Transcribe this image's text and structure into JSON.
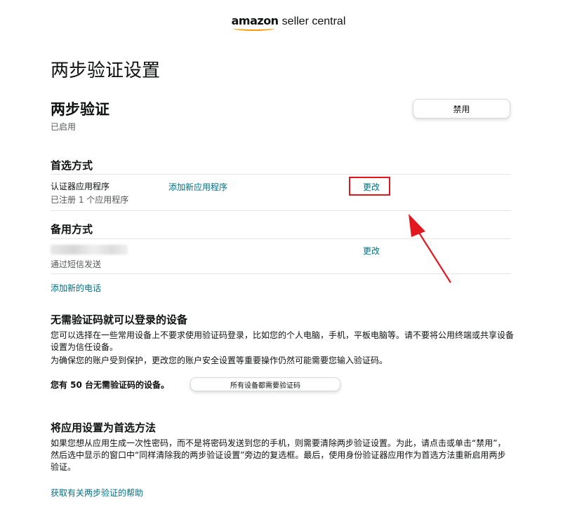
{
  "header": {
    "brand": "amazon",
    "product": "seller central"
  },
  "page": {
    "title": "两步验证设置"
  },
  "two_step": {
    "heading": "两步验证",
    "status": "已启用",
    "disable_label": "禁用"
  },
  "preferred": {
    "heading": "首选方式",
    "method": "认证器应用程序",
    "registered": "已注册 1 个应用程序",
    "add_app_label": "添加新应用程序",
    "change_label": "更改"
  },
  "backup": {
    "heading": "备用方式",
    "delivery": "通过短信发送",
    "change_label": "更改",
    "add_phone_label": "添加新的电话"
  },
  "devices": {
    "heading": "无需验证码就可以登录的设备",
    "desc1": "您可以选择在一些常用设备上不要求使用验证码登录，比如您的个人电脑，手机，平板电脑等。请不要将公用终端或共享设备设置为信任设备。",
    "desc2": "为确保您的账户受到保护，更改您的账户安全设置等重要操作仍然可能需要您输入验证码。",
    "count_text": "您有 50 台无需验证码的设备。",
    "require_all_label": "所有设备都需要验证码"
  },
  "app_preferred": {
    "heading": "将应用设置为首选方法",
    "desc": "如果您想从应用生成一次性密码，而不是将密码发送到您的手机，则需要清除两步验证设置。为此，请点击或单击“禁用”，然后选中显示的窗口中“同样清除我的两步验证设置”旁边的复选框。最后，使用身份验证器应用作为首选方法重新启用两步验证。"
  },
  "help": {
    "link_label": "获取有关两步验证的帮助"
  },
  "colors": {
    "link": "#007185",
    "highlight": "#e3171e",
    "accent": "#ff9900"
  }
}
